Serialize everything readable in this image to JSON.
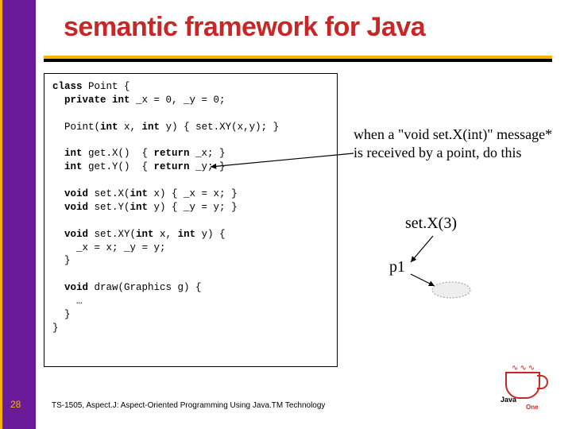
{
  "title": "semantic framework for Java",
  "code": {
    "l1a": "class",
    "l1b": " Point {",
    "l2a": "  private int",
    "l2b": " _x = 0, _y = 0;",
    "l3a": "  Point(",
    "l3b": "int",
    "l3c": " x, ",
    "l3d": "int",
    "l3e": " y) { set.XY(x,y); }",
    "l4a": "  int",
    "l4b": " get.X()  { ",
    "l4c": "return",
    "l4d": " _x; }",
    "l5a": "  int",
    "l5b": " get.Y()  { ",
    "l5c": "return",
    "l5d": " _y; }",
    "l6a": "  void",
    "l6b": " set.X(",
    "l6c": "int",
    "l6d": " x) { _x = x; }",
    "l7a": "  void",
    "l7b": " set.Y(",
    "l7c": "int",
    "l7d": " y) { _y = y; }",
    "l8a": "  void",
    "l8b": " set.XY(",
    "l8c": "int",
    "l8d": " x, ",
    "l8e": "int",
    "l8f": " y) {",
    "l9": "    _x = x; _y = y;",
    "l10": "  }",
    "l11a": "  void",
    "l11b": " draw(Graphics g) {",
    "l12": "    …",
    "l13": "  }",
    "l14": "}"
  },
  "annotation": "when a \"void set.X(int)\" message* is received by a point, do this",
  "call_label": "set.X(3)",
  "obj_label": "p1",
  "page_number": "28",
  "footer": "TS-1505, Aspect.J: Aspect-Oriented Programming Using Java.TM Technology",
  "logo": {
    "brand": "Java",
    "sub": "One"
  }
}
